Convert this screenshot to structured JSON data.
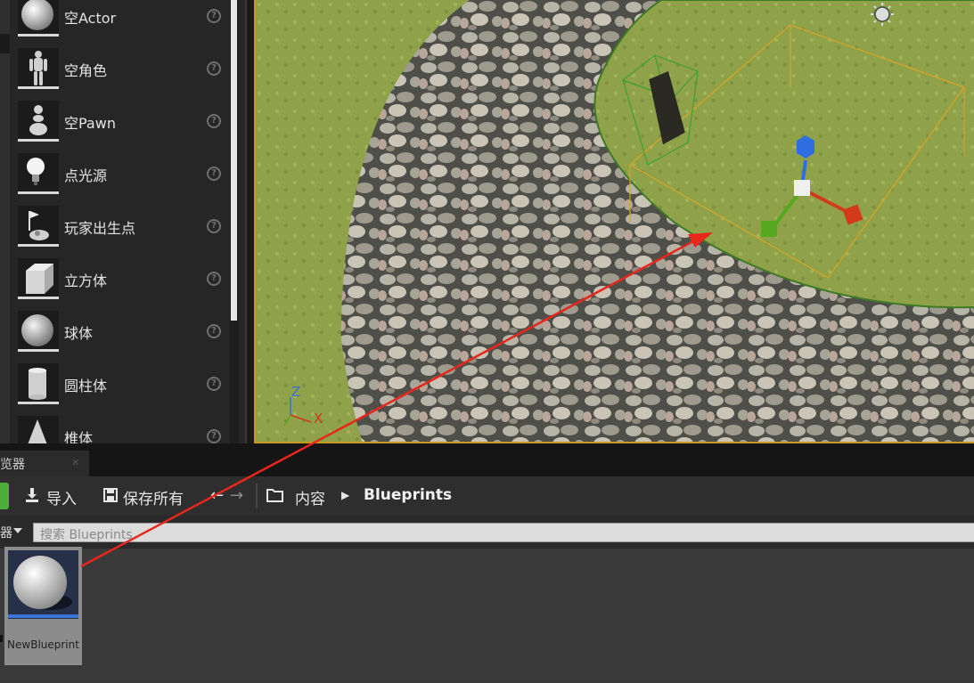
{
  "place_actors": {
    "items": [
      {
        "label": "空Actor",
        "icon": "sphere-icon"
      },
      {
        "label": "空角色",
        "icon": "mannequin-icon"
      },
      {
        "label": "空Pawn",
        "icon": "pawn-icon"
      },
      {
        "label": "点光源",
        "icon": "lightbulb-icon"
      },
      {
        "label": "玩家出生点",
        "icon": "player-start-icon"
      },
      {
        "label": "立方体",
        "icon": "cube-icon"
      },
      {
        "label": "球体",
        "icon": "sphere-icon"
      },
      {
        "label": "圆柱体",
        "icon": "cylinder-icon"
      },
      {
        "label": "椎体",
        "icon": "cone-icon"
      }
    ],
    "help_glyph": "?"
  },
  "viewport": {
    "axis_labels": {
      "z": "Z",
      "x": "X"
    }
  },
  "content_browser": {
    "tab_title": "览器",
    "tab_close": "✕",
    "toolbar": {
      "import_label": "导入",
      "save_all_label": "保存所有",
      "back_glyph": "←",
      "forward_glyph": "→"
    },
    "breadcrumb": {
      "root": "内容",
      "separator": "▶",
      "current": "Blueprints"
    },
    "filter_label": "器",
    "search": {
      "placeholder": "搜索 Blueprints",
      "value": ""
    },
    "assets": [
      {
        "name": "NewBlueprint",
        "selected": true
      }
    ]
  },
  "colors": {
    "selection_border": "#c69b1b",
    "annotation_arrow": "#e8261c",
    "asset_underline": "#3b73d6"
  }
}
